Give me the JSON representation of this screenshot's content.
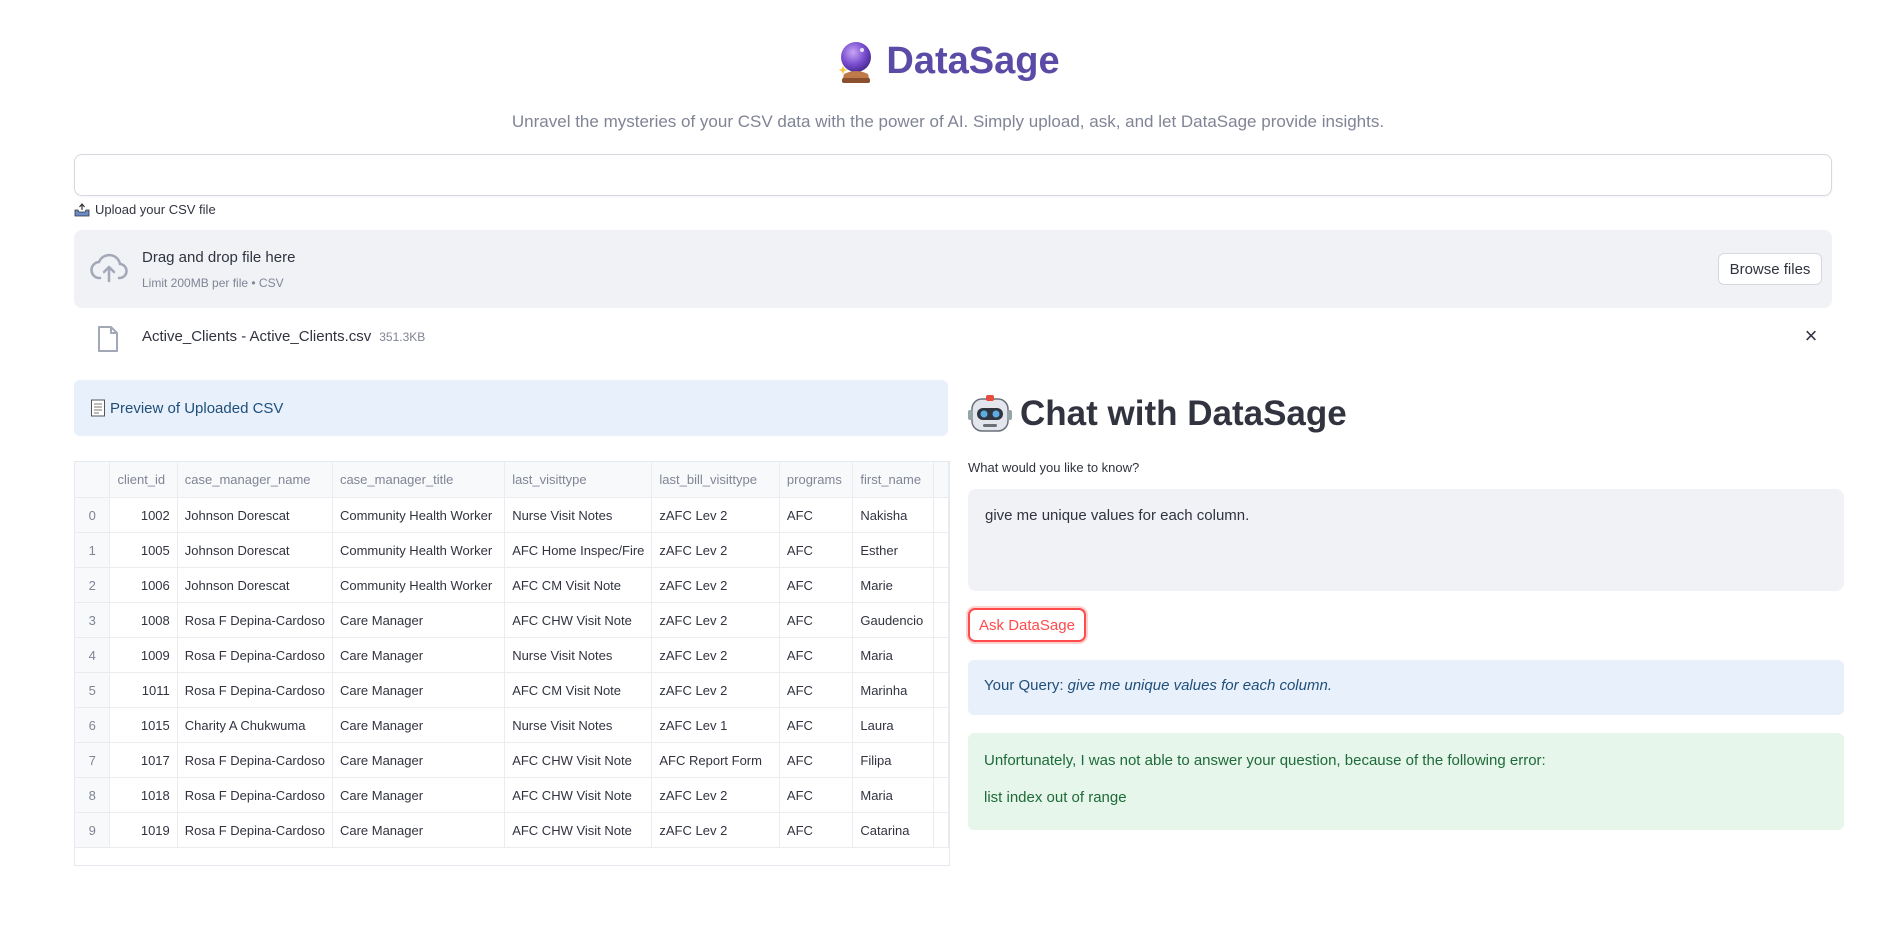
{
  "header": {
    "title": "DataSage",
    "subtitle": "Unravel the mysteries of your CSV data with the power of AI. Simply upload, ask, and let DataSage provide insights."
  },
  "uploader": {
    "label": "Upload your CSV file",
    "drop_text": "Drag and drop file here",
    "limit_text": "Limit 200MB per file • CSV",
    "browse_label": "Browse files",
    "file_name": "Active_Clients - Active_Clients.csv",
    "file_size": "351.3KB",
    "remove_icon": "×"
  },
  "preview": {
    "label": "Preview of Uploaded CSV",
    "columns": [
      "",
      "client_id",
      "case_manager_name",
      "case_manager_title",
      "last_visittype",
      "last_bill_visittype",
      "programs",
      "first_name"
    ],
    "rows": [
      [
        "0",
        "1002",
        "Johnson  Dorescat",
        "Community Health Worker",
        "Nurse Visit Notes",
        "zAFC Lev 2",
        "AFC",
        "Nakisha"
      ],
      [
        "1",
        "1005",
        "Johnson  Dorescat",
        "Community Health Worker",
        "AFC Home Inspec/Fire",
        "zAFC Lev 2",
        "AFC",
        "Esther"
      ],
      [
        "2",
        "1006",
        "Johnson  Dorescat",
        "Community Health Worker",
        "AFC CM Visit Note",
        "zAFC Lev 2",
        "AFC",
        "Marie"
      ],
      [
        "3",
        "1008",
        "Rosa F Depina-Cardoso",
        "Care Manager",
        "AFC CHW Visit Note",
        "zAFC Lev 2",
        "AFC",
        "Gaudencio"
      ],
      [
        "4",
        "1009",
        "Rosa F Depina-Cardoso",
        "Care Manager",
        "Nurse Visit Notes",
        "zAFC Lev 2",
        "AFC",
        "Maria"
      ],
      [
        "5",
        "1011",
        "Rosa F Depina-Cardoso",
        "Care Manager",
        "AFC CM Visit Note",
        "zAFC Lev 2",
        "AFC",
        "Marinha"
      ],
      [
        "6",
        "1015",
        "Charity A Chukwuma",
        "Care Manager",
        "Nurse Visit Notes",
        "zAFC Lev 1",
        "AFC",
        "Laura"
      ],
      [
        "7",
        "1017",
        "Rosa F Depina-Cardoso",
        "Care Manager",
        "AFC CHW Visit Note",
        "AFC Report Form",
        "AFC",
        "Filipa"
      ],
      [
        "8",
        "1018",
        "Rosa F Depina-Cardoso",
        "Care Manager",
        "AFC CHW Visit Note",
        "zAFC Lev 2",
        "AFC",
        "Maria"
      ],
      [
        "9",
        "1019",
        "Rosa F Depina-Cardoso",
        "Care Manager",
        "AFC CHW Visit Note",
        "zAFC Lev 2",
        "AFC",
        "Catarina"
      ]
    ]
  },
  "chat": {
    "title": "Chat with DataSage",
    "question_label": "What would you like to know?",
    "question_value": "give me unique values for each column.",
    "ask_label": "Ask DataSage",
    "query_prefix": "Your Query: ",
    "query_text": "give me unique values for each column.",
    "answer_line1": "Unfortunately, I was not able to answer your question, because of the following error:",
    "answer_line2": "list index out of range"
  },
  "colors": {
    "brand": "#5b4ba6",
    "accent": "#ff4b4b",
    "info_bg": "#e8f1fb",
    "success_bg": "#e6f6ea"
  },
  "icons": {
    "title": "crystal-ball-icon",
    "upload_label": "inbox-tray-icon",
    "dropzone": "cloud-upload-icon",
    "file": "file-icon",
    "remove": "close-icon",
    "preview": "document-icon",
    "chat": "robot-icon"
  }
}
